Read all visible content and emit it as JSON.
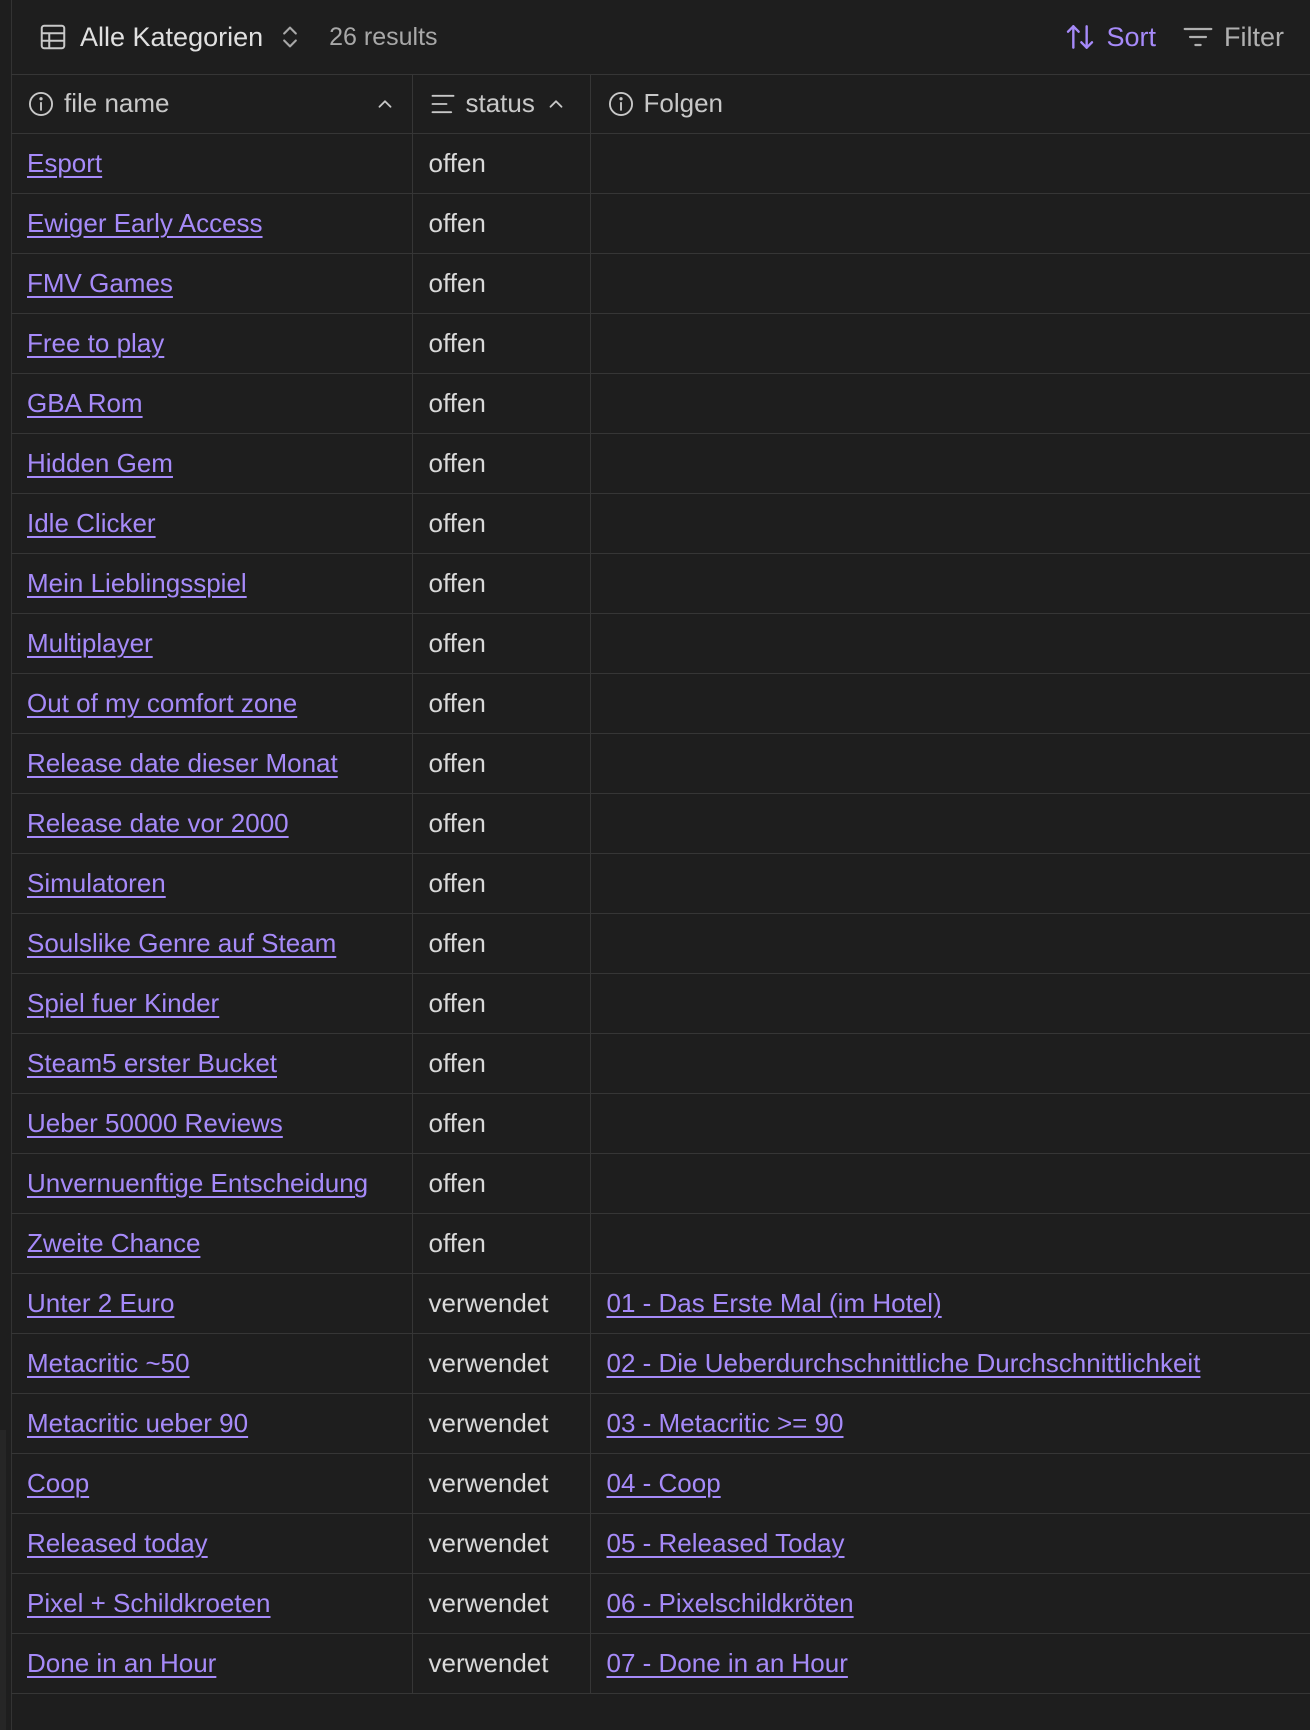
{
  "toolbar": {
    "view_label": "Alle Kategorien",
    "results": "26 results",
    "sort_label": "Sort",
    "filter_label": "Filter"
  },
  "columns": {
    "file_name": "file name",
    "status": "status",
    "folgen": "Folgen"
  },
  "rows": [
    {
      "name": "Esport",
      "status": "offen",
      "folge": ""
    },
    {
      "name": "Ewiger Early Access",
      "status": "offen",
      "folge": ""
    },
    {
      "name": "FMV Games",
      "status": "offen",
      "folge": ""
    },
    {
      "name": "Free to play",
      "status": "offen",
      "folge": ""
    },
    {
      "name": "GBA Rom",
      "status": "offen",
      "folge": ""
    },
    {
      "name": "Hidden Gem",
      "status": "offen",
      "folge": ""
    },
    {
      "name": "Idle Clicker",
      "status": "offen",
      "folge": ""
    },
    {
      "name": "Mein Lieblingsspiel",
      "status": "offen",
      "folge": ""
    },
    {
      "name": "Multiplayer",
      "status": "offen",
      "folge": ""
    },
    {
      "name": "Out of my comfort zone",
      "status": "offen",
      "folge": ""
    },
    {
      "name": "Release date dieser Monat",
      "status": "offen",
      "folge": ""
    },
    {
      "name": "Release date vor 2000",
      "status": "offen",
      "folge": ""
    },
    {
      "name": "Simulatoren",
      "status": "offen",
      "folge": ""
    },
    {
      "name": "Soulslike Genre auf Steam",
      "status": "offen",
      "folge": ""
    },
    {
      "name": "Spiel fuer Kinder",
      "status": "offen",
      "folge": ""
    },
    {
      "name": "Steam5 erster Bucket",
      "status": "offen",
      "folge": ""
    },
    {
      "name": "Ueber 50000 Reviews",
      "status": "offen",
      "folge": ""
    },
    {
      "name": "Unvernuenftige Entscheidung",
      "status": "offen",
      "folge": ""
    },
    {
      "name": "Zweite Chance",
      "status": "offen",
      "folge": ""
    },
    {
      "name": "Unter 2 Euro",
      "status": "verwendet",
      "folge": "01 - Das Erste Mal (im Hotel)"
    },
    {
      "name": "Metacritic ~50",
      "status": "verwendet",
      "folge": "02 - Die Ueberdurchschnittliche Durchschnittlichkeit"
    },
    {
      "name": "Metacritic ueber 90",
      "status": "verwendet",
      "folge": "03 - Metacritic >= 90"
    },
    {
      "name": "Coop",
      "status": "verwendet",
      "folge": "04 - Coop"
    },
    {
      "name": "Released today",
      "status": "verwendet",
      "folge": "05 - Released Today"
    },
    {
      "name": "Pixel + Schildkroeten",
      "status": "verwendet",
      "folge": "06 - Pixelschildkröten"
    },
    {
      "name": "Done in an Hour",
      "status": "verwendet",
      "folge": "07 - Done in an Hour"
    }
  ],
  "colors": {
    "background": "#1e1e1e",
    "link": "#a68af9",
    "border": "#363636",
    "text": "#dadada"
  },
  "icons": {
    "view": "table-icon",
    "view_switch": "chevron-up-down-icon",
    "sort": "sort-arrows-icon",
    "filter": "filter-icon",
    "file_name_col": "info-circle-icon",
    "status_col": "text-lines-icon",
    "folgen_col": "info-circle-icon",
    "sort_indicator": "chevron-up-icon"
  }
}
